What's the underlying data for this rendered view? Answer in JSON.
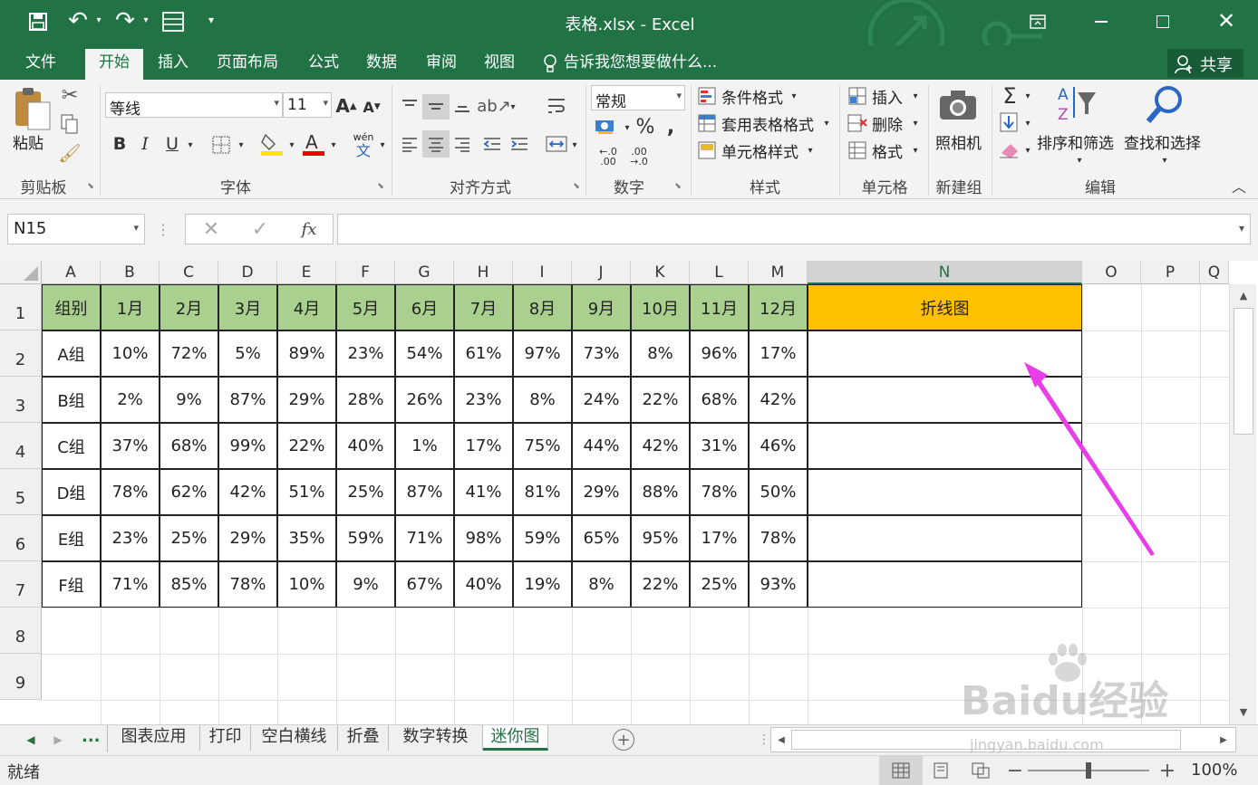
{
  "window": {
    "title": "表格.xlsx - Excel"
  },
  "tabs": {
    "file": "文件",
    "home": "开始",
    "insert": "插入",
    "layout": "页面布局",
    "formula": "公式",
    "data": "数据",
    "review": "审阅",
    "view": "视图",
    "tell": "告诉我您想要做什么...",
    "share": "共享"
  },
  "ribbon": {
    "clipboard": {
      "paste": "粘贴",
      "label": "剪贴板"
    },
    "font": {
      "name": "等线",
      "size": "11",
      "bold": "B",
      "italic": "I",
      "underline": "U",
      "label": "字体",
      "wen": "wén"
    },
    "align": {
      "label": "对齐方式"
    },
    "number": {
      "format": "常规",
      "label": "数字"
    },
    "styles": {
      "cond": "条件格式",
      "table": "套用表格格式",
      "cell": "单元格样式",
      "label": "样式"
    },
    "cells": {
      "insert": "插入",
      "delete": "删除",
      "format": "格式",
      "label": "单元格"
    },
    "newgroup": {
      "camera": "照相机",
      "label": "新建组"
    },
    "editing": {
      "sort": "排序和筛选",
      "find": "查找和选择",
      "label": "编辑"
    }
  },
  "formula": {
    "namebox": "N15",
    "fx": "fx",
    "value": ""
  },
  "grid": {
    "columns": [
      "A",
      "B",
      "C",
      "D",
      "E",
      "F",
      "G",
      "H",
      "I",
      "J",
      "K",
      "L",
      "M",
      "N",
      "O",
      "P",
      "Q"
    ],
    "rows": [
      "1",
      "2",
      "3",
      "4",
      "5",
      "6",
      "7",
      "8",
      "9"
    ],
    "header": [
      "组别",
      "1月",
      "2月",
      "3月",
      "4月",
      "5月",
      "6月",
      "7月",
      "8月",
      "9月",
      "10月",
      "11月",
      "12月",
      "折线图"
    ],
    "data": [
      [
        "A组",
        "10%",
        "72%",
        "5%",
        "89%",
        "23%",
        "54%",
        "61%",
        "97%",
        "73%",
        "8%",
        "96%",
        "17%"
      ],
      [
        "B组",
        "2%",
        "9%",
        "87%",
        "29%",
        "28%",
        "26%",
        "23%",
        "8%",
        "24%",
        "22%",
        "68%",
        "42%"
      ],
      [
        "C组",
        "37%",
        "68%",
        "99%",
        "22%",
        "40%",
        "1%",
        "17%",
        "75%",
        "44%",
        "42%",
        "31%",
        "46%"
      ],
      [
        "D组",
        "78%",
        "62%",
        "42%",
        "51%",
        "25%",
        "87%",
        "41%",
        "81%",
        "29%",
        "88%",
        "78%",
        "50%"
      ],
      [
        "E组",
        "23%",
        "25%",
        "29%",
        "35%",
        "59%",
        "71%",
        "98%",
        "59%",
        "65%",
        "95%",
        "17%",
        "78%"
      ],
      [
        "F组",
        "71%",
        "85%",
        "78%",
        "10%",
        "9%",
        "67%",
        "40%",
        "19%",
        "8%",
        "22%",
        "25%",
        "93%"
      ]
    ],
    "colors": {
      "header_green": "#a9d08e",
      "header_orange": "#ffc000",
      "arrow": "#e83ee8"
    }
  },
  "sheets": {
    "more": "...",
    "tabs": [
      "图表应用",
      "打印",
      "空白横线",
      "折叠",
      "数字转换",
      "迷你图"
    ],
    "active": "迷你图"
  },
  "status": {
    "ready": "就绪",
    "zoom": "100%"
  },
  "watermark": {
    "text": "Baidu经验",
    "url": "jingyan.baidu.com"
  }
}
